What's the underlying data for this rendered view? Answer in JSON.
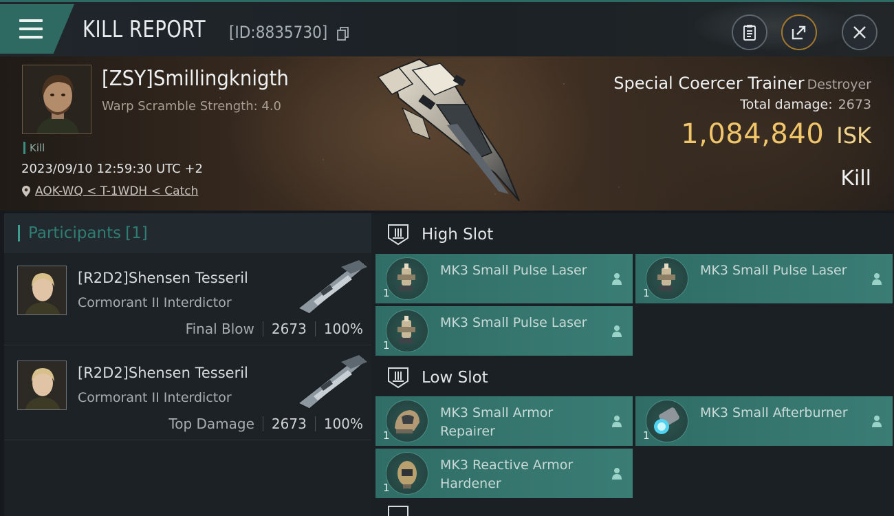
{
  "header": {
    "title": "KILL REPORT",
    "id_label": "[ID:8835730]",
    "icons": [
      "menu-icon",
      "copy-icon",
      "clipboard-icon",
      "share-icon",
      "close-icon"
    ]
  },
  "victim": {
    "name": "[ZSY]Smillingknigth",
    "subtitle": "Warp Scramble Strength: 4.0",
    "tag": "Kill",
    "datetime": "2023/09/10 12:59:30 UTC +2",
    "location": "AOK-WQ < T-1WDH < Catch",
    "ship_name": "Special Coercer Trainer",
    "ship_class": "Destroyer",
    "total_damage_label": "Total damage:",
    "total_damage": "2673",
    "isk_value": "1,084,840",
    "isk_unit": "ISK",
    "result": "Kill"
  },
  "participants": {
    "label": "Participants",
    "count": "[1]",
    "items": [
      {
        "name": "[R2D2]Shensen Tesseril",
        "ship": "Cormorant II Interdictor",
        "role": "Final Blow",
        "damage": "2673",
        "percent": "100%"
      },
      {
        "name": "[R2D2]Shensen Tesseril",
        "ship": "Cormorant II Interdictor",
        "role": "Top Damage",
        "damage": "2673",
        "percent": "100%"
      }
    ]
  },
  "slots": {
    "high": {
      "label": "High Slot",
      "modules": [
        {
          "name": "MK3 Small Pulse Laser",
          "qty": "1"
        },
        {
          "name": "MK3 Small Pulse Laser",
          "qty": "1"
        },
        {
          "name": "MK3 Small Pulse Laser",
          "qty": "1"
        }
      ]
    },
    "low": {
      "label": "Low Slot",
      "modules": [
        {
          "name": "MK3 Small Armor Repairer",
          "qty": "1"
        },
        {
          "name": "MK3 Small Afterburner",
          "qty": "1"
        },
        {
          "name": "MK3 Reactive Armor Hardener",
          "qty": "1"
        }
      ]
    }
  },
  "colors": {
    "accent_teal": "#2e6962",
    "isk_gold": "#f1c66a",
    "module_bg": "#3a7d75"
  }
}
